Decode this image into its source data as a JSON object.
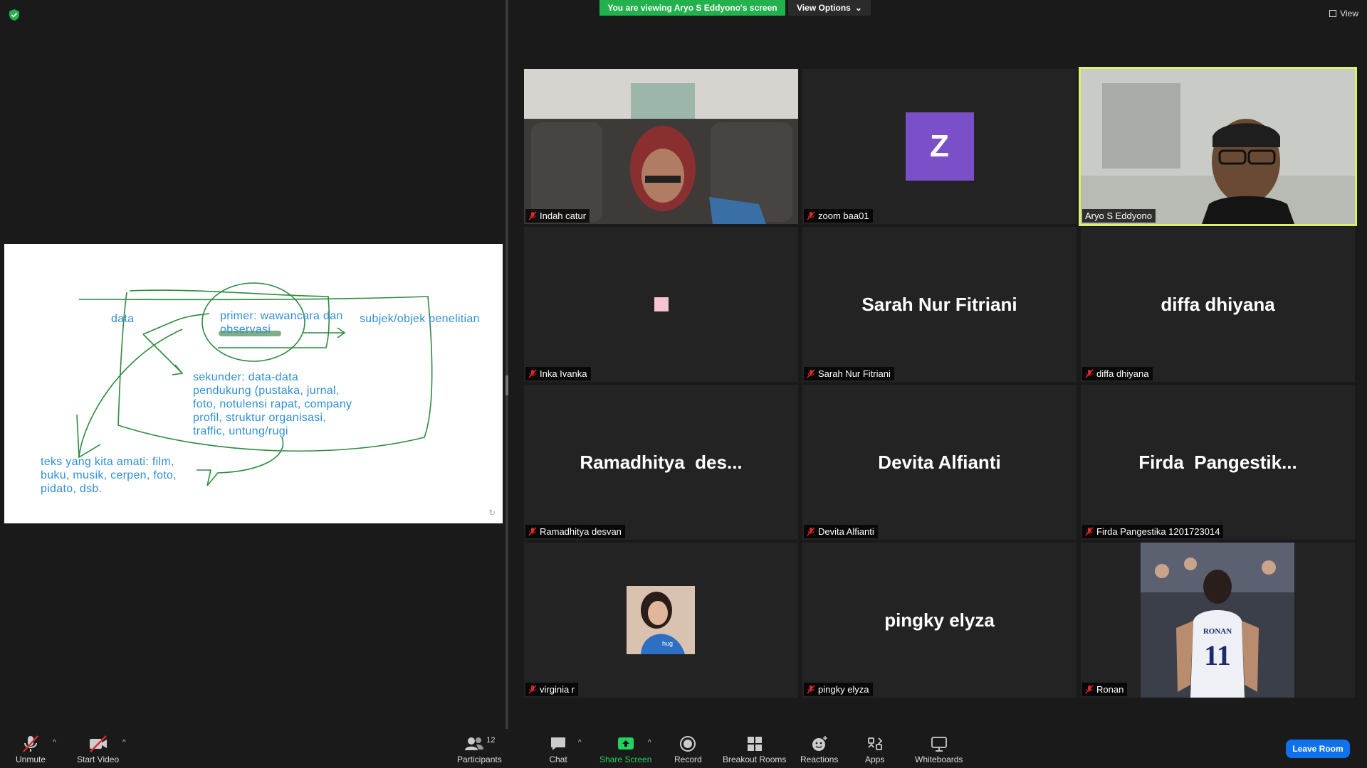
{
  "banner": {
    "viewing_text": "You are viewing Aryo S Eddyono's screen",
    "view_options": "View Options"
  },
  "top_right": {
    "view_label": "View"
  },
  "whiteboard": {
    "data": "data",
    "primer": "primer: wawancara dan\nobservasi",
    "subjek": "subjek/objek penelitian",
    "sekunder": "sekunder: data-data\npendukung (pustaka, jurnal,\nfoto, notulensi rapat, company\nprofil, struktur organisasi,\ntraffic, untung/rugi",
    "teks": "teks yang kita amati: film,\nbuku, musik, cerpen, foto,\npidato, dsb."
  },
  "participants": [
    {
      "label": "Indah catur",
      "kind": "video"
    },
    {
      "label": "zoom baa01",
      "kind": "avatar",
      "initial": "Z"
    },
    {
      "label": "Aryo S Eddyono",
      "kind": "video",
      "active": true
    },
    {
      "label": "Inka Ivanka",
      "kind": "square"
    },
    {
      "label": "Sarah Nur Fitriani",
      "big": "Sarah Nur Fitriani"
    },
    {
      "label": "diffa dhiyana",
      "big": "diffa dhiyana"
    },
    {
      "label": "Ramadhitya desvan",
      "big": "Ramadhitya  des..."
    },
    {
      "label": "Devita Alfianti",
      "big": "Devita Alfianti"
    },
    {
      "label": "Firda Pangestika 1201723014",
      "big": "Firda  Pangestik..."
    },
    {
      "label": "virginia r",
      "kind": "photo"
    },
    {
      "label": "pingky elyza",
      "big": "pingky elyza"
    },
    {
      "label": "Ronan",
      "kind": "photo",
      "jersey_name": "RONAN",
      "jersey_number": "11"
    }
  ],
  "toolbar": {
    "unmute": "Unmute",
    "start_video": "Start Video",
    "participants": "Participants",
    "participants_count": "12",
    "chat": "Chat",
    "share_screen": "Share Screen",
    "record": "Record",
    "breakout_rooms": "Breakout Rooms",
    "reactions": "Reactions",
    "apps": "Apps",
    "whiteboards": "Whiteboards",
    "leave_room": "Leave Room"
  },
  "colors": {
    "banner": "#23b14d",
    "active_border": "#d8f26a",
    "leave": "#0e72ed",
    "avatar": "#7b4fc8",
    "ink_blue": "#2f8fd8",
    "ink_green": "#2e8b3e"
  }
}
